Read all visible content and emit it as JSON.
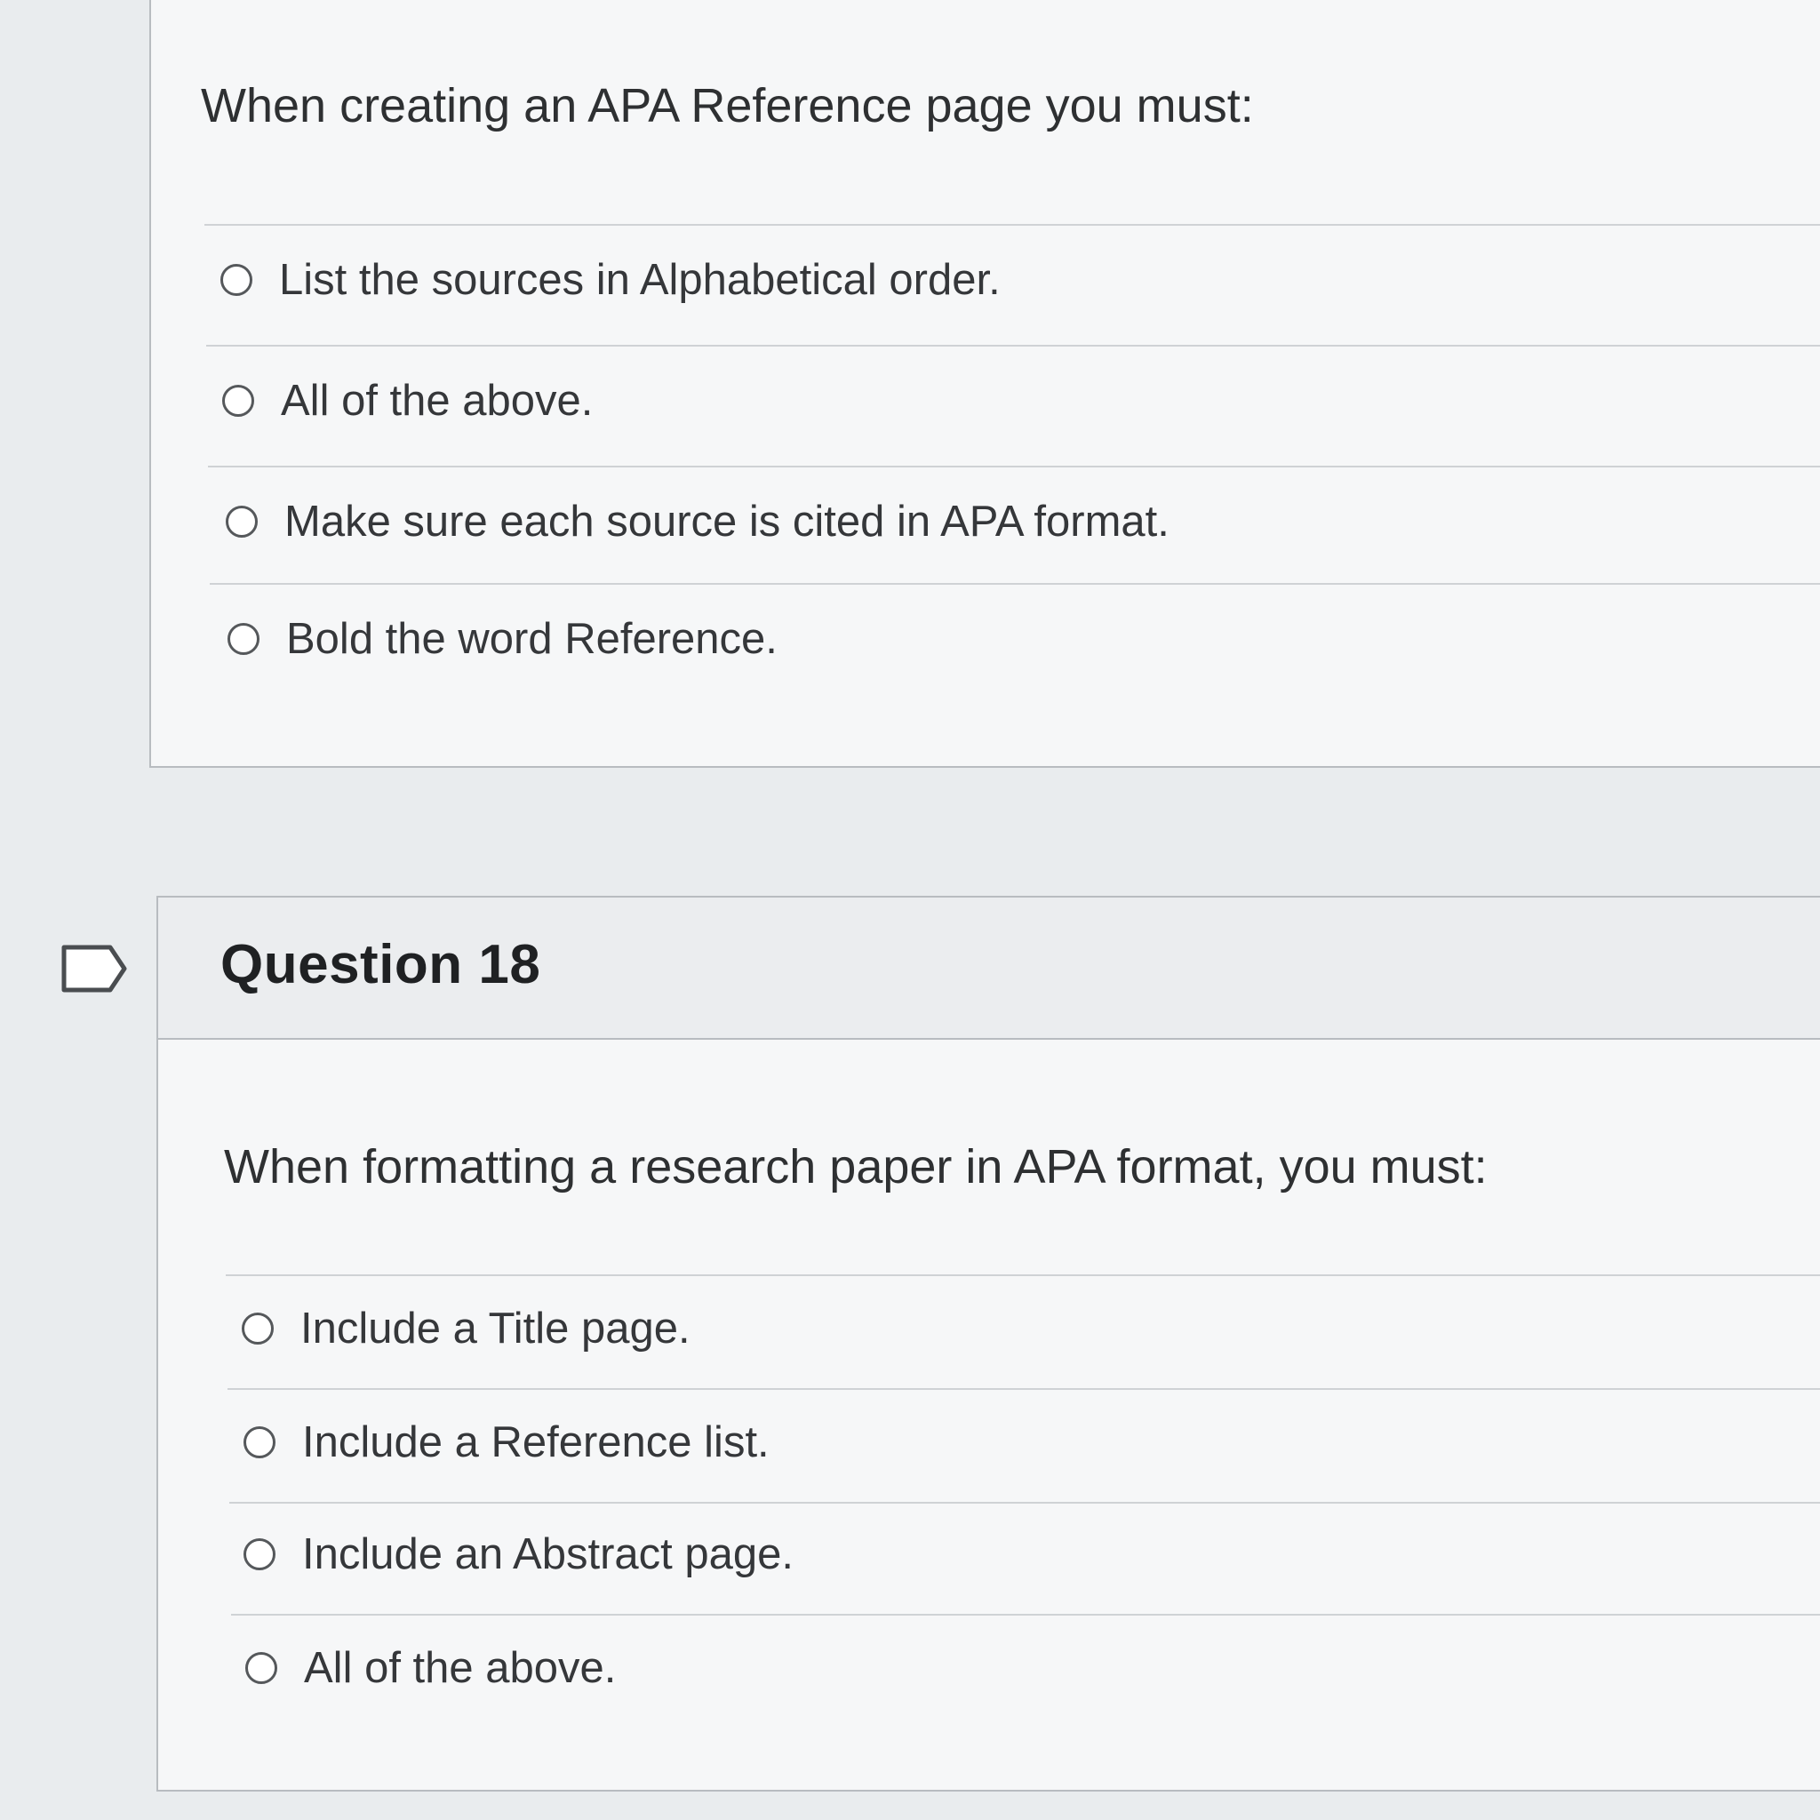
{
  "question_17": {
    "prompt": "When creating an APA Reference page you must:",
    "options": [
      {
        "label": "List the sources in Alphabetical order.",
        "selected": false
      },
      {
        "label": "All of the above.",
        "selected": false
      },
      {
        "label": "Make sure each source is cited in APA format.",
        "selected": false
      },
      {
        "label": "Bold the word Reference.",
        "selected": false
      }
    ]
  },
  "question_18": {
    "title": "Question 18",
    "prompt": "When formatting a research paper in APA format, you must:",
    "options": [
      {
        "label": "Include a Title page.",
        "selected": false
      },
      {
        "label": "Include a Reference list.",
        "selected": false
      },
      {
        "label": "Include an Abstract page.",
        "selected": false
      },
      {
        "label": "All of the above.",
        "selected": false
      }
    ]
  },
  "icons": {
    "flag": "bookmark-flag-icon",
    "radio": "radio-unchecked-icon"
  },
  "colors": {
    "background": "#e9ecee",
    "card": "#f6f7f8",
    "header": "#ebedef",
    "border": "#b8bcc0",
    "text": "#2e3032"
  }
}
